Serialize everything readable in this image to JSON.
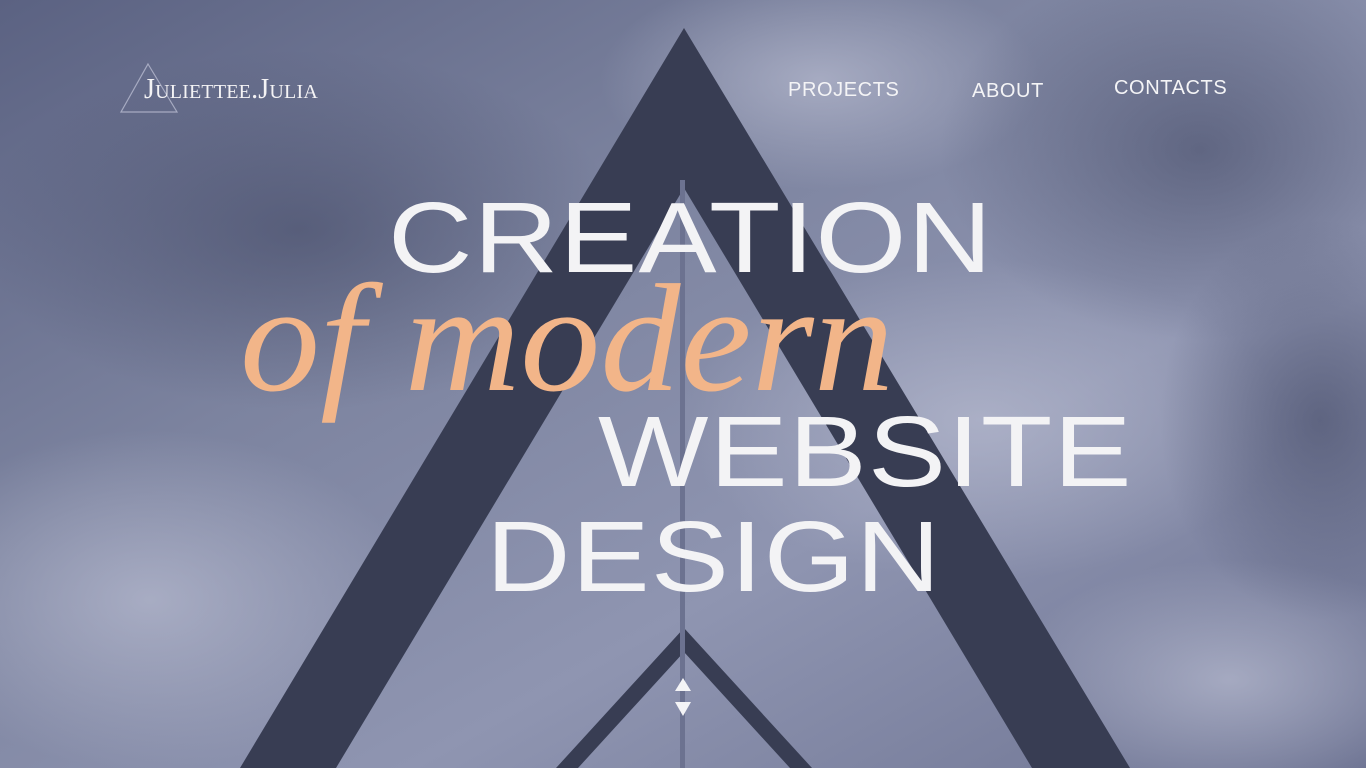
{
  "header": {
    "logo_text": "Juliettee.Julia",
    "nav": {
      "projects": "PROJECTS",
      "about": "ABOUT",
      "contacts": "CONTACTS"
    }
  },
  "hero": {
    "line1": "CREATION",
    "line2": "of modern",
    "line3": "WEBSITE",
    "line4": "DESIGN"
  },
  "icons": {
    "logo": "triangle-outline-icon",
    "scroll_up": "triangle-up-icon",
    "scroll_down": "triangle-down-icon"
  },
  "colors": {
    "accent": "#f2b589",
    "text": "#f3f3f5",
    "structure": "#383d53",
    "sky": "#7f86a3"
  }
}
